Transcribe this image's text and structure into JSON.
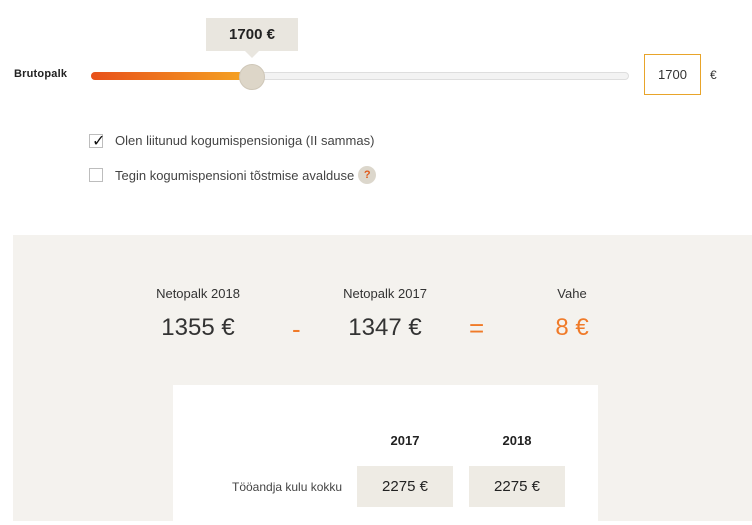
{
  "slider": {
    "tooltip": "1700 €",
    "label": "Brutopalk",
    "value": 1700,
    "fraction": 0.3,
    "input_value": "1700",
    "currency": "€"
  },
  "options": [
    {
      "label": "Olen liitunud kogumispensioniga (II sammas)",
      "checked": true
    },
    {
      "label": "Tegin kogumispensioni tõstmise avalduse",
      "checked": false,
      "help_icon": "question-icon",
      "help": "?"
    }
  ],
  "summary": {
    "col1_label": "Netopalk 2018",
    "col1_value": "1355 €",
    "minus": "-",
    "col2_label": "Netopalk 2017",
    "col2_value": "1347 €",
    "equals": "=",
    "col3_label": "Vahe",
    "col3_value": "8 €"
  },
  "table": {
    "years": [
      "2017",
      "2018"
    ],
    "rows": [
      {
        "label": "Tööandja kulu kokku",
        "values": [
          "2275 €",
          "2275 €"
        ]
      }
    ]
  },
  "colors": {
    "accent": "#f07a28",
    "slider_start": "#e8501a",
    "slider_end": "#f5a623",
    "panel_bg": "#f4f2ee"
  }
}
